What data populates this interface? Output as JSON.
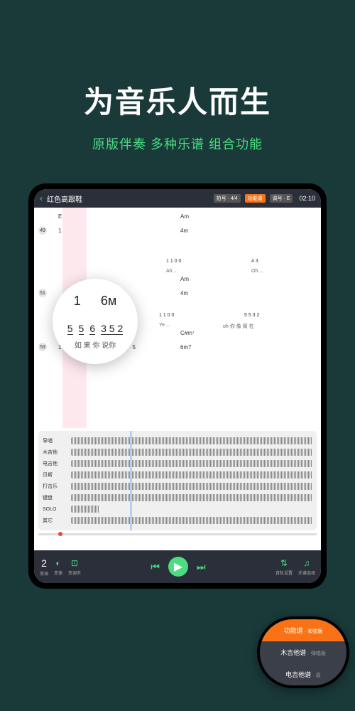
{
  "hero": {
    "title": "为音乐人而生",
    "subtitle": "原版伴奏  多种乐谱  组合功能"
  },
  "header": {
    "song_title": "红色高跟鞋",
    "badge1": "拍号 · 4/4",
    "badge2": "功能谱",
    "badge3": "调号 · E",
    "time": "02:10"
  },
  "score": {
    "chord_E": "E",
    "chord_Am": "Am",
    "chord_4m": "4m",
    "chord_A": "A",
    "chord_Csharp": "C#m⁷",
    "chord_6m7": "6m7",
    "bar_49": "49",
    "bar_51": "51",
    "bar_53": "53",
    "notes_row1a": "1",
    "notes_row1b": "5 5·",
    "notes_row1c": "4  3",
    "lyric_ah": "Ah....",
    "lyric_oh": "Oh....",
    "lyric_ye": "Ye....",
    "lyric_ohni": "oh 你  像  窝  在",
    "notes_mid_a": "1 1  0    0",
    "notes_mid_b": "5  5  3 2",
    "notes_row2a": "3    5·",
    "n1": "1",
    "n5": "5"
  },
  "magnifier": {
    "top_left": "1",
    "top_right": "6м",
    "mid": [
      "5",
      "5",
      "6",
      "3 5 2"
    ],
    "lyric": "如 果 你  说你"
  },
  "tracks": [
    "导唱",
    "木吉他",
    "电吉他",
    "贝斯",
    "打击乐",
    "键盘",
    "SOLO",
    "其它"
  ],
  "controls": {
    "transpose": "2",
    "transpose_label": "变调",
    "tempo_label": "变速",
    "tuning_label": "变调夫",
    "track_label": "音轨设置",
    "score_label": "乐谱选择"
  },
  "popup": {
    "item1": "功能谱",
    "item1_sub": "· 和弦版",
    "item2": "木吉他谱",
    "item2_sub": "· 弹唱版",
    "item3": "电吉他谱",
    "item3_sub": "· 原"
  }
}
